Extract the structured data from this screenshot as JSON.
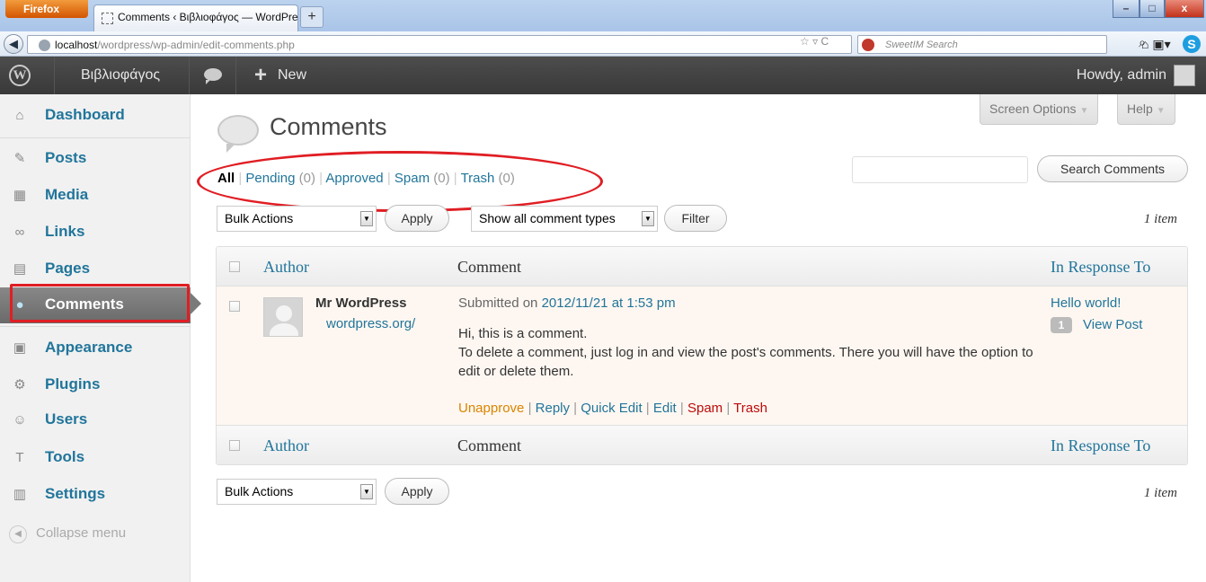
{
  "browser": {
    "menu_button": "Firefox",
    "tab_title": "Comments ‹ Βιβλιοφάγος — WordPress",
    "new_tab": "+",
    "url_host": "localhost",
    "url_path": "/wordpress/wp-admin/edit-comments.php",
    "search_placeholder": "SweetIM Search",
    "window_controls": {
      "minimize": "–",
      "maximize": "□",
      "close": "x"
    }
  },
  "adminbar": {
    "site_name": "Βιβλιοφάγος",
    "new_label": "New",
    "howdy": "Howdy, admin"
  },
  "sidebar": {
    "items": [
      {
        "label": "Dashboard",
        "icon": "home-icon"
      },
      {
        "label": "Posts",
        "icon": "pin-icon"
      },
      {
        "label": "Media",
        "icon": "media-icon"
      },
      {
        "label": "Links",
        "icon": "link-icon"
      },
      {
        "label": "Pages",
        "icon": "page-icon"
      },
      {
        "label": "Comments",
        "icon": "comment-icon"
      },
      {
        "label": "Appearance",
        "icon": "appearance-icon"
      },
      {
        "label": "Plugins",
        "icon": "plugin-icon"
      },
      {
        "label": "Users",
        "icon": "users-icon"
      },
      {
        "label": "Tools",
        "icon": "tools-icon"
      },
      {
        "label": "Settings",
        "icon": "settings-icon"
      }
    ],
    "collapse": "Collapse menu"
  },
  "header": {
    "title": "Comments",
    "screen_options": "Screen Options",
    "help": "Help"
  },
  "filters": {
    "all": "All",
    "pending": "Pending",
    "pending_count": "(0)",
    "approved": "Approved",
    "spam": "Spam",
    "spam_count": "(0)",
    "trash": "Trash",
    "trash_count": "(0)",
    "sep": "|"
  },
  "search": {
    "button": "Search Comments",
    "value": ""
  },
  "toolbar": {
    "bulk_actions": "Bulk Actions",
    "apply": "Apply",
    "comment_types": "Show all comment types",
    "filter": "Filter",
    "item_count": "1 item"
  },
  "table": {
    "columns": [
      "Author",
      "Comment",
      "In Response To"
    ],
    "row": {
      "author": "Mr WordPress",
      "author_url": "wordpress.org/",
      "submitted_prefix": "Submitted on",
      "submitted_date": "2012/11/21 at 1:53 pm",
      "text_line1": "Hi, this is a comment.",
      "text_line2": "To delete a comment, just log in and view the post's comments. There you will have the option to edit or delete them.",
      "actions": {
        "unapprove": "Unapprove",
        "reply": "Reply",
        "quick_edit": "Quick Edit",
        "edit": "Edit",
        "spam": "Spam",
        "trash": "Trash"
      },
      "response_post": "Hello world!",
      "response_count": "1",
      "view_post": "View Post"
    }
  },
  "colors": {
    "link": "#21759b",
    "adminbar": "#464646",
    "highlight_annotation": "#e01e24",
    "unapprove": "#d98500",
    "danger": "#bc0b0b"
  }
}
